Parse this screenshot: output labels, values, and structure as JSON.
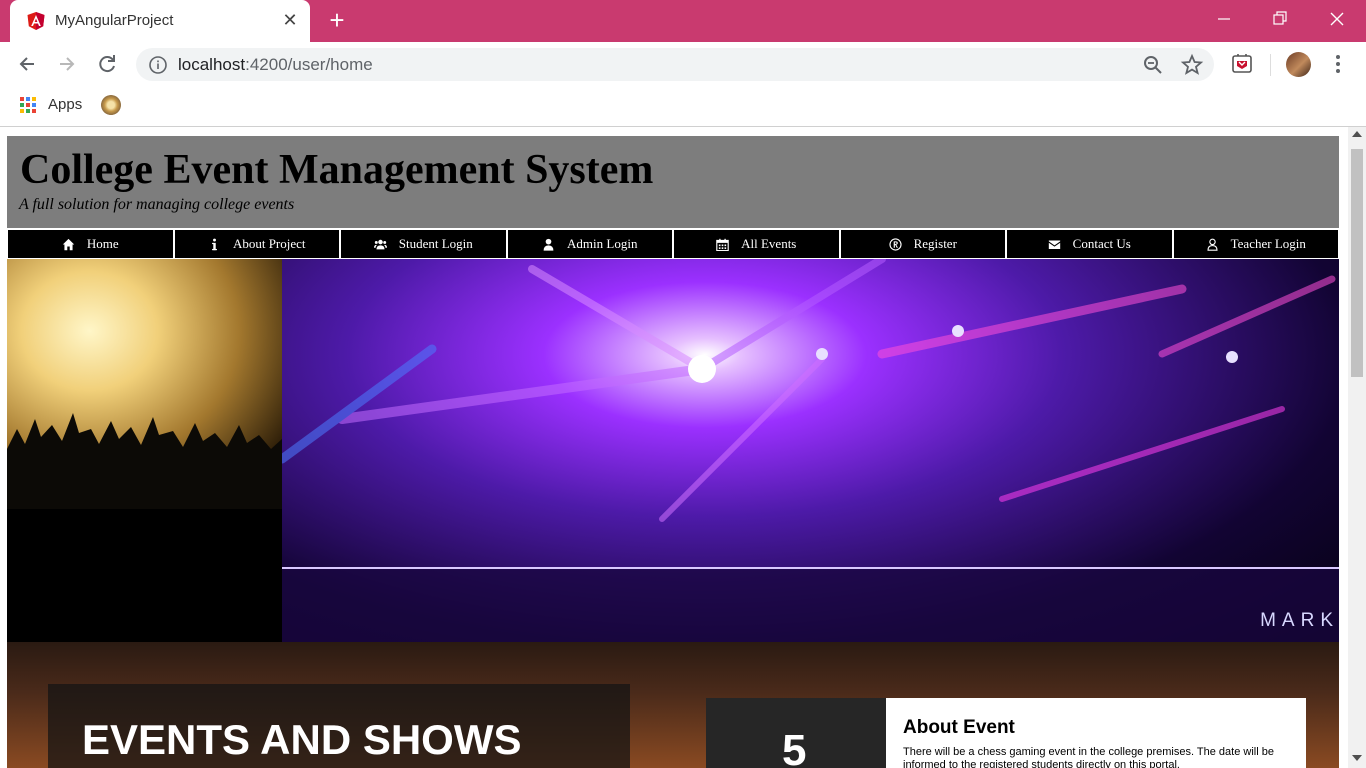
{
  "browser": {
    "tab_title": "MyAngularProject",
    "url_host": "localhost",
    "url_path": ":4200/user/home",
    "bookmarks": {
      "apps_label": "Apps"
    },
    "colors": {
      "tab_strip": "#c93a6f"
    }
  },
  "page": {
    "title": "College Event Management System",
    "subtitle": "A full solution for managing college events",
    "nav": [
      {
        "label": "Home",
        "icon": "home-icon"
      },
      {
        "label": "About Project",
        "icon": "info-icon"
      },
      {
        "label": "Student Login",
        "icon": "users-icon"
      },
      {
        "label": "Admin Login",
        "icon": "user-icon"
      },
      {
        "label": "All Events",
        "icon": "calendar-icon"
      },
      {
        "label": "Register",
        "icon": "registered-icon"
      },
      {
        "label": "Contact Us",
        "icon": "envelope-icon"
      },
      {
        "label": "Teacher Login",
        "icon": "user-outline-icon"
      }
    ],
    "hero_watermark": "MARK",
    "events_heading": "EVENTS AND SHOWS",
    "event_count": "5",
    "about_title": "About Event",
    "about_text": "There will be a chess gaming event in the college premises. The date will be informed to the registered students directly on this portal."
  }
}
